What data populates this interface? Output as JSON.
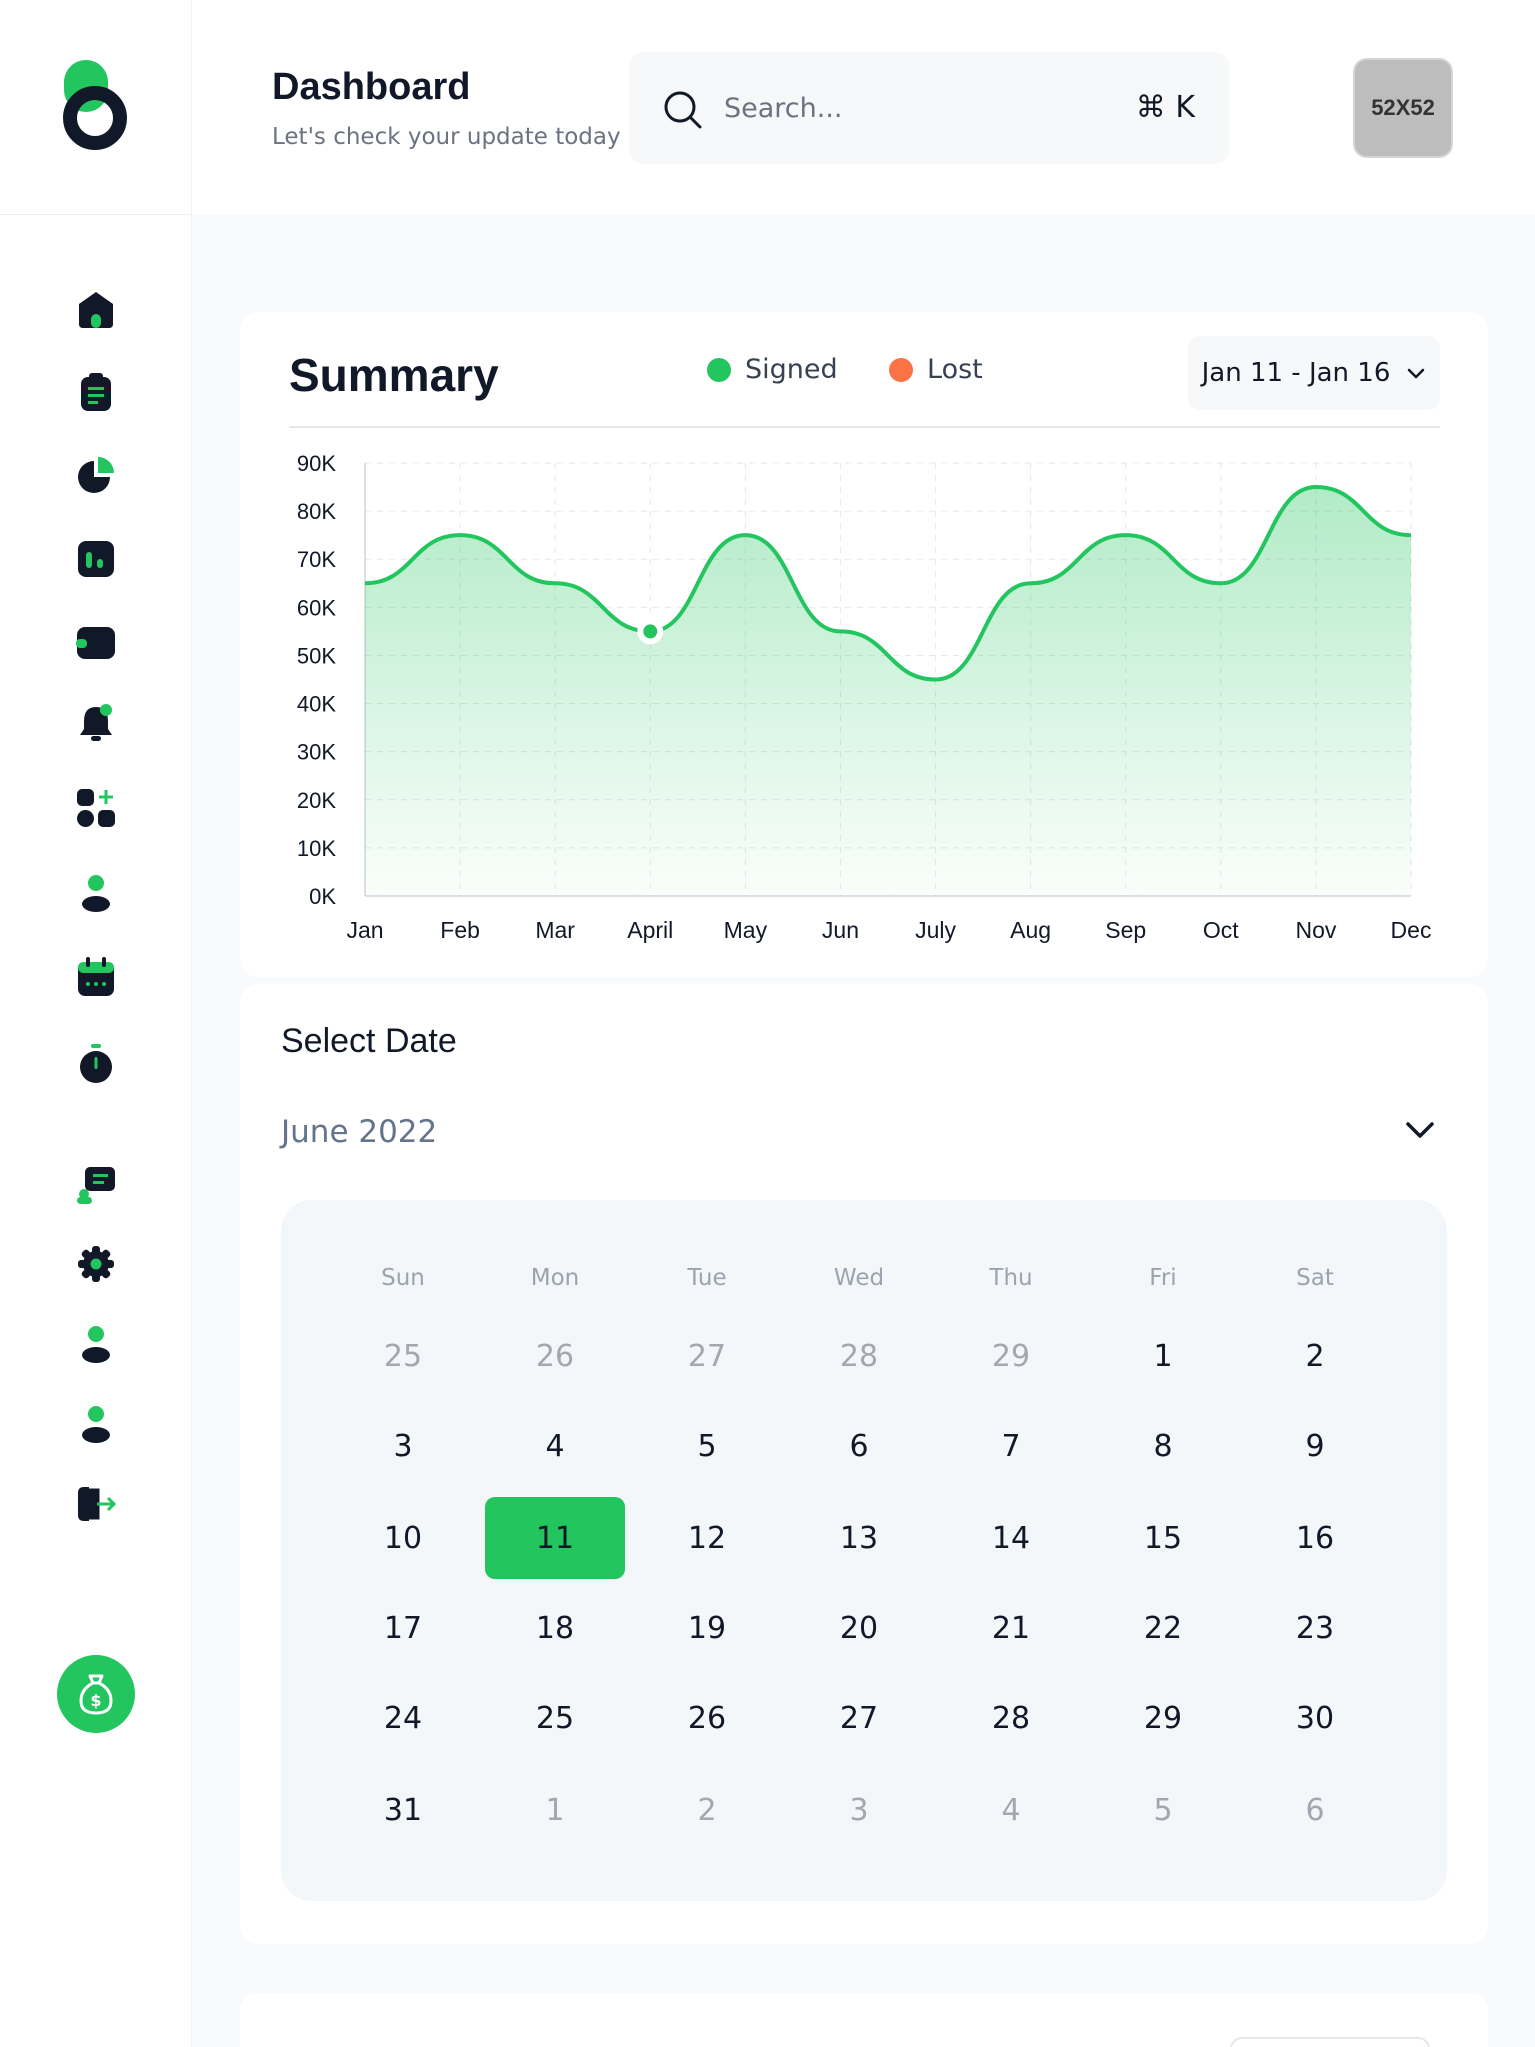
{
  "header": {
    "title": "Dashboard",
    "subtitle": "Let's check your update today",
    "search_placeholder": "Search...",
    "search_shortcut": "⌘ K",
    "avatar_label": "52X52"
  },
  "sidebar": {
    "items": [
      {
        "name": "home-icon"
      },
      {
        "name": "clipboard-icon"
      },
      {
        "name": "pie-chart-icon"
      },
      {
        "name": "bar-chart-icon"
      },
      {
        "name": "wallet-icon"
      },
      {
        "name": "bell-icon"
      },
      {
        "name": "add-widget-icon"
      },
      {
        "name": "user-icon"
      },
      {
        "name": "calendar-icon"
      },
      {
        "name": "timer-icon"
      },
      {
        "name": "chat-icon"
      },
      {
        "name": "settings-icon"
      },
      {
        "name": "profile-icon"
      },
      {
        "name": "account-icon"
      },
      {
        "name": "logout-icon"
      }
    ],
    "money_button_icon": "money-bag-icon"
  },
  "colors": {
    "accent": "#22c55e",
    "lost": "#f97347",
    "dark": "#111827"
  },
  "summary": {
    "title": "Summary",
    "legend": [
      {
        "label": "Signed",
        "color": "#22c55e"
      },
      {
        "label": "Lost",
        "color": "#f97347"
      }
    ],
    "date_range": "Jan 11 - Jan 16"
  },
  "chart_data": {
    "type": "area",
    "x": [
      "Jan",
      "Feb",
      "Mar",
      "April",
      "May",
      "Jun",
      "July",
      "Aug",
      "Sep",
      "Oct",
      "Nov",
      "Dec"
    ],
    "series": [
      {
        "name": "Signed",
        "values": [
          65000,
          75000,
          65000,
          55000,
          75000,
          55000,
          45000,
          65000,
          75000,
          65000,
          85000,
          75000
        ]
      }
    ],
    "y_ticks": [
      "0K",
      "10K",
      "20K",
      "30K",
      "40K",
      "50K",
      "60K",
      "70K",
      "80K",
      "90K"
    ],
    "ylim": [
      0,
      90000
    ],
    "highlight_point": {
      "x": "April",
      "y": 55000
    },
    "grid": true
  },
  "calendar": {
    "title": "Select Date",
    "month": "June 2022",
    "weekdays": [
      "Sun",
      "Mon",
      "Tue",
      "Wed",
      "Thu",
      "Fri",
      "Sat"
    ],
    "weeks": [
      [
        {
          "d": "25",
          "m": true
        },
        {
          "d": "26",
          "m": true
        },
        {
          "d": "27",
          "m": true
        },
        {
          "d": "28",
          "m": true
        },
        {
          "d": "29",
          "m": true
        },
        {
          "d": "1"
        },
        {
          "d": "2"
        }
      ],
      [
        {
          "d": "3"
        },
        {
          "d": "4"
        },
        {
          "d": "5"
        },
        {
          "d": "6"
        },
        {
          "d": "7"
        },
        {
          "d": "8"
        },
        {
          "d": "9"
        }
      ],
      [
        {
          "d": "10"
        },
        {
          "d": "11",
          "s": true
        },
        {
          "d": "12"
        },
        {
          "d": "13"
        },
        {
          "d": "14"
        },
        {
          "d": "15"
        },
        {
          "d": "16"
        }
      ],
      [
        {
          "d": "17"
        },
        {
          "d": "18"
        },
        {
          "d": "19"
        },
        {
          "d": "20"
        },
        {
          "d": "21"
        },
        {
          "d": "22"
        },
        {
          "d": "23"
        }
      ],
      [
        {
          "d": "24"
        },
        {
          "d": "25"
        },
        {
          "d": "26"
        },
        {
          "d": "27"
        },
        {
          "d": "28"
        },
        {
          "d": "29"
        },
        {
          "d": "30"
        }
      ],
      [
        {
          "d": "31"
        },
        {
          "d": "1",
          "m": true
        },
        {
          "d": "2",
          "m": true
        },
        {
          "d": "3",
          "m": true
        },
        {
          "d": "4",
          "m": true
        },
        {
          "d": "5",
          "m": true
        },
        {
          "d": "6",
          "m": true
        }
      ]
    ]
  }
}
